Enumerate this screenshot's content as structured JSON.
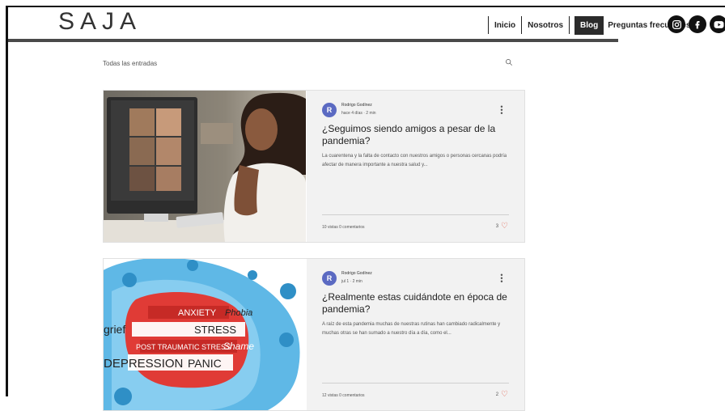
{
  "header": {
    "logo": "SAJA",
    "nav": [
      {
        "label": "Inicio",
        "active": false
      },
      {
        "label": "Nosotros",
        "active": false
      },
      {
        "label": "Blog",
        "active": true
      },
      {
        "label": "Preguntas frecuentes",
        "active": false
      }
    ],
    "social": [
      "instagram-icon",
      "facebook-icon",
      "youtube-icon"
    ]
  },
  "blog": {
    "filter_label": "Todas las entradas",
    "search_icon": "search-icon"
  },
  "posts": [
    {
      "author_initial": "R",
      "author": "Rodrigo Godínez",
      "meta": "hace 4 días · 2 min",
      "title": "¿Seguimos siendo amigos a pesar de la pandemia?",
      "excerpt": "La cuarentena y la falta de contacto con nuestros amigos o personas cercanas podría afectar de manera importante a nuestra salud y...",
      "stats": "10 vistas   0 comentarios",
      "likes": "3"
    },
    {
      "author_initial": "R",
      "author": "Rodrigo Godínez",
      "meta": "jul 1 · 2 min",
      "title": "¿Realmente estas cuidándote en época de pandemia?",
      "excerpt": "A raíz de esta pandemia muchas de nuestras rutinas han cambiado radicalmente y muchas otras se han sumado a nuestro día a día, como el...",
      "stats": "12 vistas   0 comentarios",
      "likes": "2",
      "image_words": [
        "ANXIETY",
        "Phobia",
        "grief",
        "STRESS",
        "POST TRAUMATIC STRESS",
        "Shame",
        "DEPRESSION",
        "PANIC"
      ]
    }
  ],
  "colors": {
    "accent_heart": "#e05a47",
    "avatar": "#5b6ac2",
    "nav_active_bg": "#2b2b2b"
  }
}
